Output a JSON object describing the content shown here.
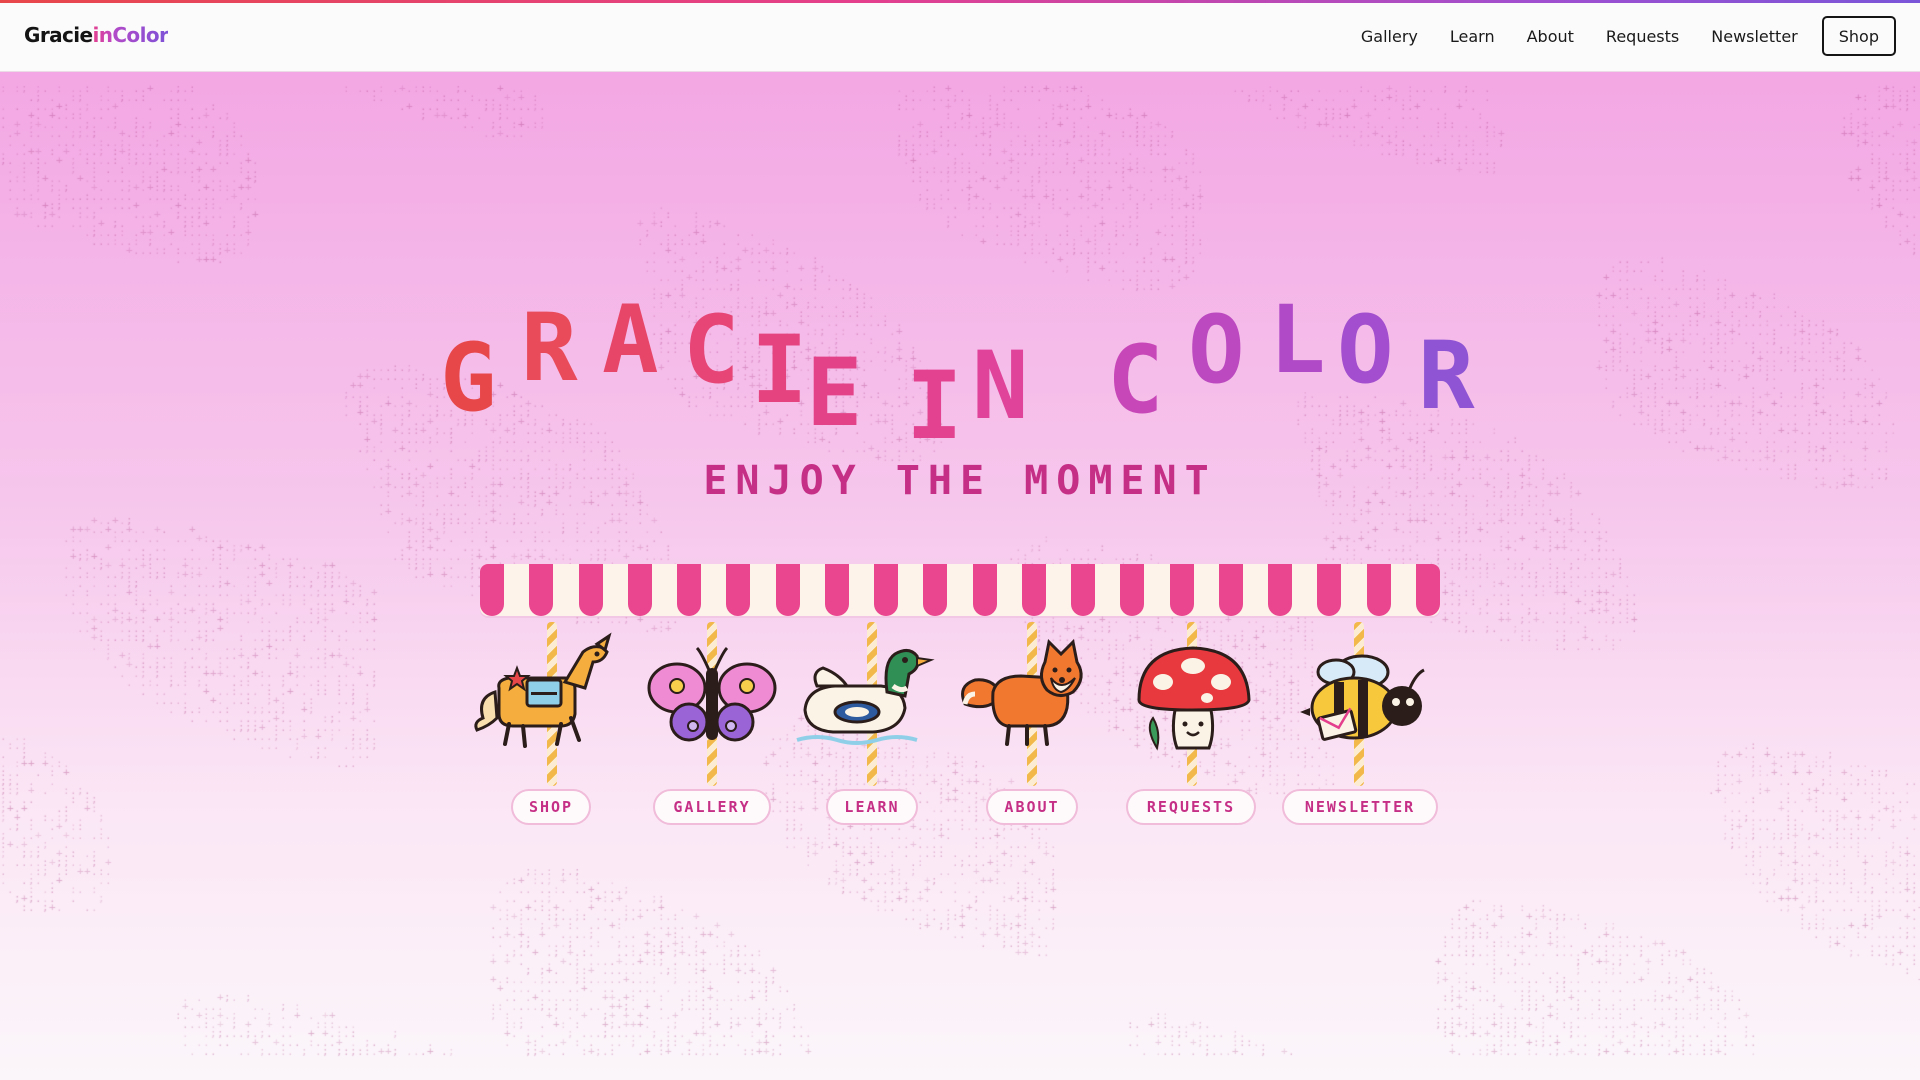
{
  "header": {
    "logo": {
      "part1": "Gracie",
      "part2": "in",
      "part3": "Color"
    },
    "nav": [
      {
        "label": "Gallery"
      },
      {
        "label": "Learn"
      },
      {
        "label": "About"
      },
      {
        "label": "Requests"
      },
      {
        "label": "Newsletter"
      }
    ],
    "shop_label": "Shop"
  },
  "hero": {
    "title_letters": [
      "G",
      "R",
      "A",
      "C",
      "I",
      "E",
      "I",
      "N",
      "C",
      "O",
      "L",
      "O",
      "R"
    ],
    "tagline": "ENJOY THE MOMENT",
    "rides": [
      {
        "label": "SHOP",
        "icon": "horse-icon"
      },
      {
        "label": "GALLERY",
        "icon": "butterfly-icon"
      },
      {
        "label": "LEARN",
        "icon": "duck-icon"
      },
      {
        "label": "ABOUT",
        "icon": "fox-icon"
      },
      {
        "label": "REQUESTS",
        "icon": "mushroom-icon"
      },
      {
        "label": "NEWSLETTER",
        "icon": "bee-icon"
      }
    ]
  },
  "colors": {
    "title_red": "#e8474a",
    "title_pink": "#e43f8d",
    "title_purple": "#a04fd0",
    "tagline": "#c62f86",
    "awning_stripe": "#e9468f"
  }
}
